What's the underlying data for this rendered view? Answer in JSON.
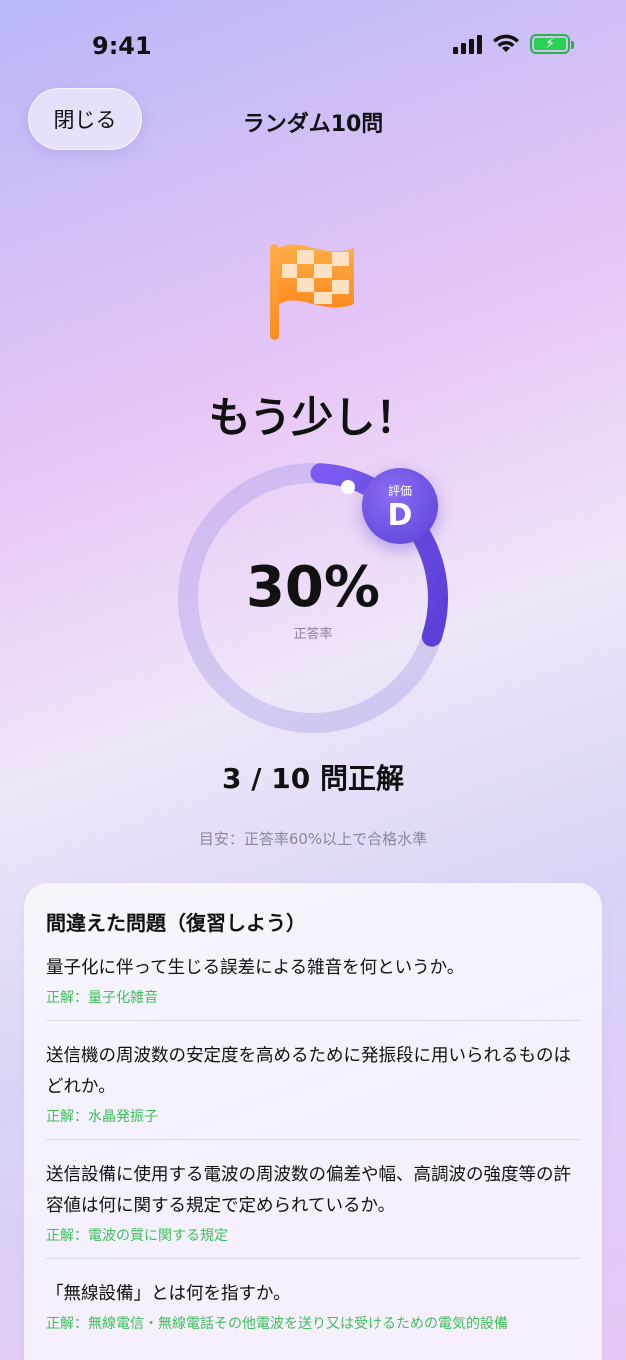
{
  "status_bar": {
    "time": "9:41",
    "icons": [
      "cellular-signal-icon",
      "wifi-icon",
      "battery-charging-icon"
    ],
    "battery_color": "#2bd152"
  },
  "nav": {
    "close_label": "閉じる",
    "title": "ランダム10問"
  },
  "result": {
    "flag_icon": "checkered-flag-icon",
    "headline": "もう少し！",
    "percent_text": "30%",
    "percent_value": 30,
    "percent_label": "正答率",
    "grade_label": "評価",
    "grade": "D",
    "score": "3 / 10 問正解",
    "hint": "目安：正答率60%以上で合格水準"
  },
  "colors": {
    "accent": "#6b4fe6",
    "correct_text": "#3fbf5b",
    "flag": "#ff9a2e"
  },
  "review": {
    "title": "間違えた問題（復習しよう）",
    "items": [
      {
        "question": "量子化に伴って生じる誤差による雑音を何というか。",
        "answer": "正解：量子化雑音"
      },
      {
        "question": "送信機の周波数の安定度を高めるために発振段に用いられるものはどれか。",
        "answer": "正解：水晶発振子"
      },
      {
        "question": "送信設備に使用する電波の周波数の偏差や幅、高調波の強度等の許容値は何に関する規定で定められているか。",
        "answer": "正解：電波の質に関する規定"
      },
      {
        "question": "「無線設備」とは何を指すか。",
        "answer": "正解：無線電信・無線電話その他電波を送り又は受けるための電気的設備"
      }
    ]
  }
}
